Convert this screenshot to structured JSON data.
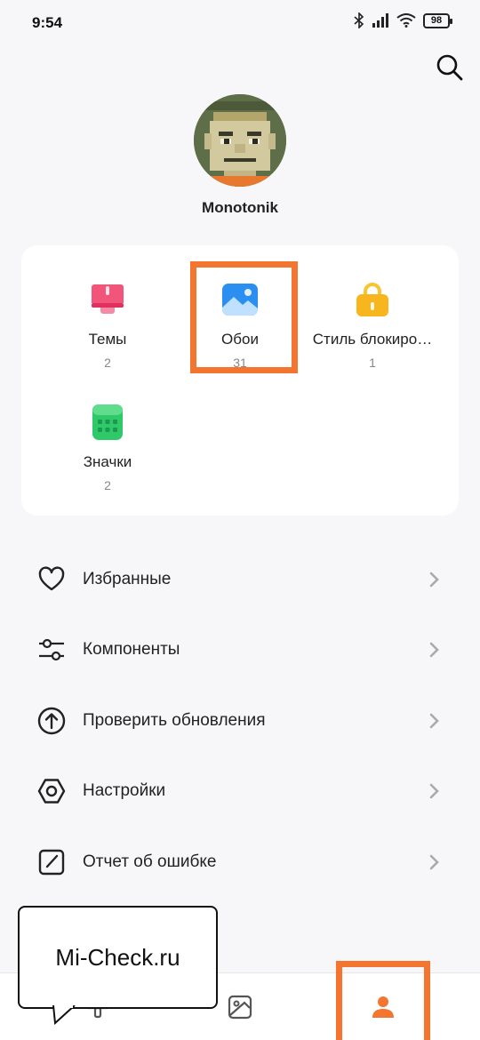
{
  "status_bar": {
    "time": "9:54",
    "battery": "98"
  },
  "profile": {
    "username": "Monotonik"
  },
  "categories": [
    {
      "label": "Темы",
      "count": "2",
      "icon": "themes-icon",
      "color": "#f2557a"
    },
    {
      "label": "Обои",
      "count": "31",
      "icon": "wallpaper-icon",
      "color": "#2a8ff0"
    },
    {
      "label": "Стиль блокиро…",
      "count": "1",
      "icon": "lock-style-icon",
      "color": "#f7b51e"
    },
    {
      "label": "Значки",
      "count": "2",
      "icon": "icons-icon",
      "color": "#2fc96a"
    }
  ],
  "menu": [
    {
      "label": "Избранные",
      "icon": "heart-icon"
    },
    {
      "label": "Компоненты",
      "icon": "sliders-icon"
    },
    {
      "label": "Проверить обновления",
      "icon": "update-icon"
    },
    {
      "label": "Настройки",
      "icon": "settings-icon"
    },
    {
      "label": "Отчет об ошибке",
      "icon": "feedback-icon"
    }
  ],
  "bottom_nav": [
    {
      "name": "tab-themes",
      "icon": "brush-icon"
    },
    {
      "name": "tab-wallpapers",
      "icon": "wallpaper-tab-icon"
    },
    {
      "name": "tab-profile",
      "icon": "person-icon",
      "active": true,
      "active_color": "#f37530"
    }
  ],
  "watermark": {
    "text": "Mi-Check.ru"
  },
  "accent_color": "#f37530"
}
